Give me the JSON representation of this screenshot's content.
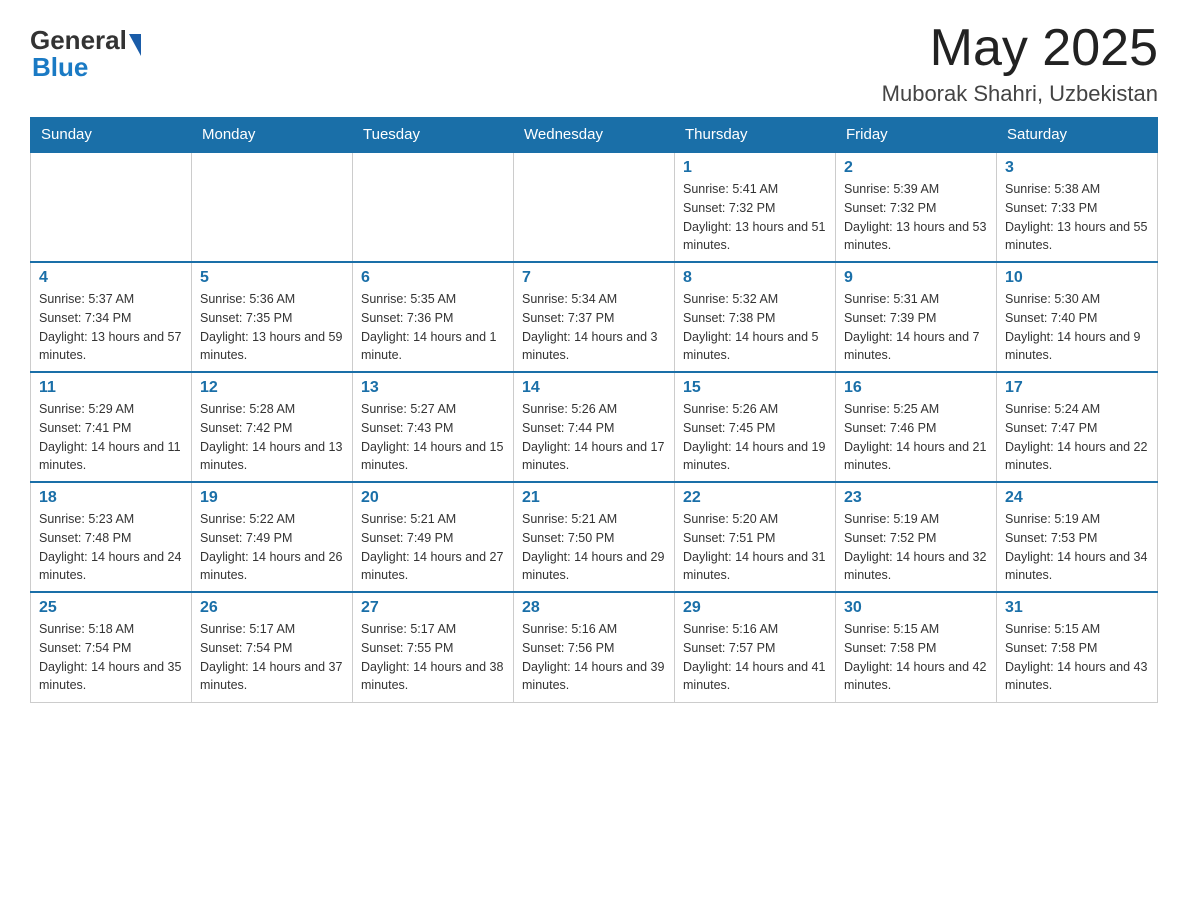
{
  "header": {
    "logo": {
      "general": "General",
      "blue": "Blue"
    },
    "title": "May 2025",
    "location": "Muborak Shahri, Uzbekistan"
  },
  "weekdays": [
    "Sunday",
    "Monday",
    "Tuesday",
    "Wednesday",
    "Thursday",
    "Friday",
    "Saturday"
  ],
  "weeks": [
    [
      {
        "day": "",
        "info": ""
      },
      {
        "day": "",
        "info": ""
      },
      {
        "day": "",
        "info": ""
      },
      {
        "day": "",
        "info": ""
      },
      {
        "day": "1",
        "info": "Sunrise: 5:41 AM\nSunset: 7:32 PM\nDaylight: 13 hours and 51 minutes."
      },
      {
        "day": "2",
        "info": "Sunrise: 5:39 AM\nSunset: 7:32 PM\nDaylight: 13 hours and 53 minutes."
      },
      {
        "day": "3",
        "info": "Sunrise: 5:38 AM\nSunset: 7:33 PM\nDaylight: 13 hours and 55 minutes."
      }
    ],
    [
      {
        "day": "4",
        "info": "Sunrise: 5:37 AM\nSunset: 7:34 PM\nDaylight: 13 hours and 57 minutes."
      },
      {
        "day": "5",
        "info": "Sunrise: 5:36 AM\nSunset: 7:35 PM\nDaylight: 13 hours and 59 minutes."
      },
      {
        "day": "6",
        "info": "Sunrise: 5:35 AM\nSunset: 7:36 PM\nDaylight: 14 hours and 1 minute."
      },
      {
        "day": "7",
        "info": "Sunrise: 5:34 AM\nSunset: 7:37 PM\nDaylight: 14 hours and 3 minutes."
      },
      {
        "day": "8",
        "info": "Sunrise: 5:32 AM\nSunset: 7:38 PM\nDaylight: 14 hours and 5 minutes."
      },
      {
        "day": "9",
        "info": "Sunrise: 5:31 AM\nSunset: 7:39 PM\nDaylight: 14 hours and 7 minutes."
      },
      {
        "day": "10",
        "info": "Sunrise: 5:30 AM\nSunset: 7:40 PM\nDaylight: 14 hours and 9 minutes."
      }
    ],
    [
      {
        "day": "11",
        "info": "Sunrise: 5:29 AM\nSunset: 7:41 PM\nDaylight: 14 hours and 11 minutes."
      },
      {
        "day": "12",
        "info": "Sunrise: 5:28 AM\nSunset: 7:42 PM\nDaylight: 14 hours and 13 minutes."
      },
      {
        "day": "13",
        "info": "Sunrise: 5:27 AM\nSunset: 7:43 PM\nDaylight: 14 hours and 15 minutes."
      },
      {
        "day": "14",
        "info": "Sunrise: 5:26 AM\nSunset: 7:44 PM\nDaylight: 14 hours and 17 minutes."
      },
      {
        "day": "15",
        "info": "Sunrise: 5:26 AM\nSunset: 7:45 PM\nDaylight: 14 hours and 19 minutes."
      },
      {
        "day": "16",
        "info": "Sunrise: 5:25 AM\nSunset: 7:46 PM\nDaylight: 14 hours and 21 minutes."
      },
      {
        "day": "17",
        "info": "Sunrise: 5:24 AM\nSunset: 7:47 PM\nDaylight: 14 hours and 22 minutes."
      }
    ],
    [
      {
        "day": "18",
        "info": "Sunrise: 5:23 AM\nSunset: 7:48 PM\nDaylight: 14 hours and 24 minutes."
      },
      {
        "day": "19",
        "info": "Sunrise: 5:22 AM\nSunset: 7:49 PM\nDaylight: 14 hours and 26 minutes."
      },
      {
        "day": "20",
        "info": "Sunrise: 5:21 AM\nSunset: 7:49 PM\nDaylight: 14 hours and 27 minutes."
      },
      {
        "day": "21",
        "info": "Sunrise: 5:21 AM\nSunset: 7:50 PM\nDaylight: 14 hours and 29 minutes."
      },
      {
        "day": "22",
        "info": "Sunrise: 5:20 AM\nSunset: 7:51 PM\nDaylight: 14 hours and 31 minutes."
      },
      {
        "day": "23",
        "info": "Sunrise: 5:19 AM\nSunset: 7:52 PM\nDaylight: 14 hours and 32 minutes."
      },
      {
        "day": "24",
        "info": "Sunrise: 5:19 AM\nSunset: 7:53 PM\nDaylight: 14 hours and 34 minutes."
      }
    ],
    [
      {
        "day": "25",
        "info": "Sunrise: 5:18 AM\nSunset: 7:54 PM\nDaylight: 14 hours and 35 minutes."
      },
      {
        "day": "26",
        "info": "Sunrise: 5:17 AM\nSunset: 7:54 PM\nDaylight: 14 hours and 37 minutes."
      },
      {
        "day": "27",
        "info": "Sunrise: 5:17 AM\nSunset: 7:55 PM\nDaylight: 14 hours and 38 minutes."
      },
      {
        "day": "28",
        "info": "Sunrise: 5:16 AM\nSunset: 7:56 PM\nDaylight: 14 hours and 39 minutes."
      },
      {
        "day": "29",
        "info": "Sunrise: 5:16 AM\nSunset: 7:57 PM\nDaylight: 14 hours and 41 minutes."
      },
      {
        "day": "30",
        "info": "Sunrise: 5:15 AM\nSunset: 7:58 PM\nDaylight: 14 hours and 42 minutes."
      },
      {
        "day": "31",
        "info": "Sunrise: 5:15 AM\nSunset: 7:58 PM\nDaylight: 14 hours and 43 minutes."
      }
    ]
  ]
}
